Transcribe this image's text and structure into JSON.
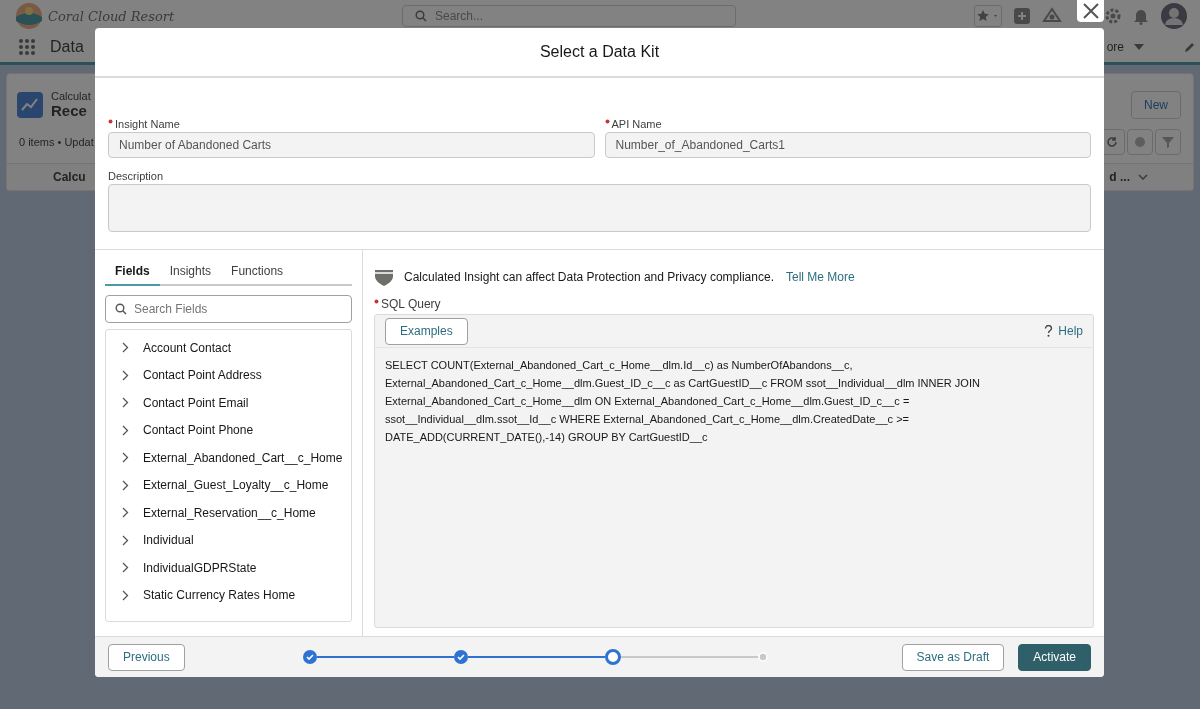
{
  "app": {
    "brand": "Coral Cloud Resort",
    "search_placeholder": "Search...",
    "nav_title": "Data",
    "nav_more": "ore",
    "page_kicker": "Calculat",
    "page_title": "Rece",
    "page_meta": "0 items • Updat",
    "new_button": "New",
    "column_1": "Calcu",
    "column_2": "d ..."
  },
  "modal": {
    "title": "Select a Data Kit",
    "fields": [
      {
        "label": "Insight Name",
        "required": true,
        "value": "Number of Abandoned Carts"
      },
      {
        "label": "API Name",
        "required": true,
        "value": "Number_of_Abandoned_Carts1"
      }
    ],
    "description": {
      "label": "Description"
    },
    "tabs": [
      {
        "label": "Fields",
        "selected": true
      },
      {
        "label": "Insights",
        "selected": false
      },
      {
        "label": "Functions",
        "selected": false
      }
    ],
    "search": {
      "placeholder": "Search Fields"
    },
    "objects": [
      {
        "label": "Account Contact",
        "expanded": false
      },
      {
        "label": "Contact Point Address",
        "expanded": false
      },
      {
        "label": "Contact Point Email",
        "expanded": false
      },
      {
        "label": "Contact Point Phone",
        "expanded": false
      },
      {
        "label": "External_Abandoned_Cart__c_Home",
        "expanded": false
      },
      {
        "label": "External_Guest_Loyalty__c_Home",
        "expanded": false
      },
      {
        "label": "External_Reservation__c_Home",
        "expanded": false
      },
      {
        "label": "Individual",
        "expanded": false
      },
      {
        "label": "IndividualGDPRState",
        "expanded": false
      },
      {
        "label": "Static Currency Rates Home",
        "expanded": false
      }
    ],
    "notice": "Calculated Insight can affect Data Protection and Privacy compliance.",
    "notice_link": "Tell Me More",
    "query": {
      "label": "SQL Query",
      "required": true,
      "examples_button": "Examples",
      "help": "Help",
      "value": "SELECT COUNT(External_Abandoned_Cart_c_Home__dlm.Id__c) as NumberOfAbandons__c, External_Abandoned_Cart_c_Home__dlm.Guest_ID_c__c as CartGuestID__c FROM ssot__Individual__dlm INNER JOIN External_Abandoned_Cart_c_Home__dlm ON External_Abandoned_Cart_c_Home__dlm.Guest_ID_c__c = ssot__Individual__dlm.ssot__Id__c WHERE External_Abandoned_Cart_c_Home__dlm.CreatedDate__c >= DATE_ADD(CURRENT_DATE(),-14) GROUP BY CartGuestID__c"
    },
    "previous_button": "Previous",
    "steps": [
      {
        "done": true,
        "current": false
      },
      {
        "done": true,
        "current": false
      },
      {
        "done": false,
        "current": true
      },
      {
        "done": false,
        "current": false
      }
    ],
    "draft_button": "Save as Draft",
    "activate_button": "Activate"
  }
}
